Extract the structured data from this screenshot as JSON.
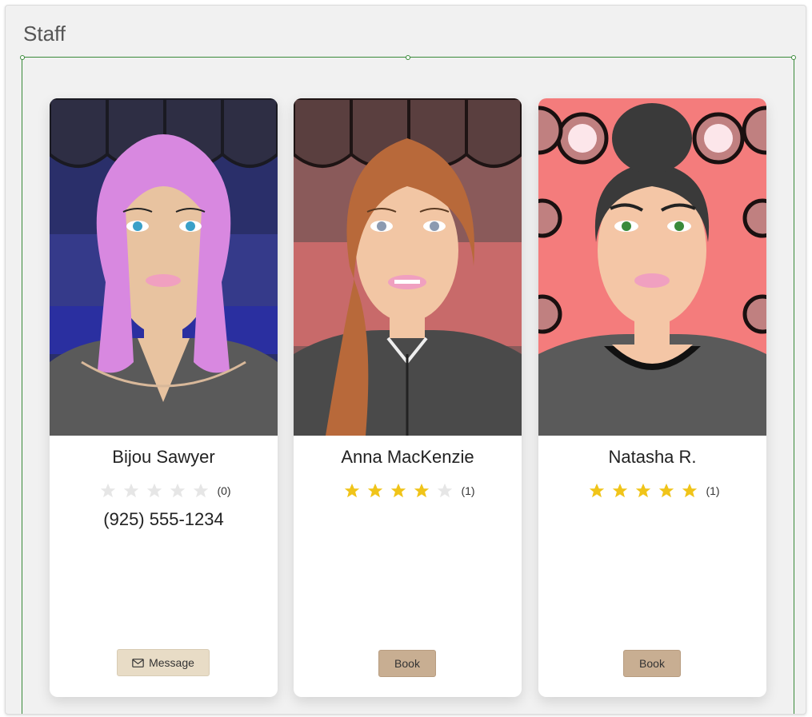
{
  "panel": {
    "title": "Staff"
  },
  "staff": [
    {
      "name": "Bijou Sawyer",
      "rating": 0,
      "rating_count": "(0)",
      "phone": "(925) 555-1234",
      "button_label": "Message",
      "button_icon": "envelope-icon",
      "hair_color": "#d888e0",
      "eye_color": "#3aa0c8",
      "background_color": "#2a2f6a"
    },
    {
      "name": "Anna MacKenzie",
      "rating": 4,
      "rating_count": "(1)",
      "phone": "",
      "button_label": "Book",
      "hair_color": "#b8693a",
      "eye_color": "#8c9ab0",
      "background_color": "#8a5a5a"
    },
    {
      "name": "Natasha R.",
      "rating": 5,
      "rating_count": "(1)",
      "phone": "",
      "button_label": "Book",
      "hair_color": "#3a3a3a",
      "eye_color": "#3a8a3a",
      "background_color": "#f47c7c"
    }
  ],
  "colors": {
    "star_filled": "#f0c419",
    "star_empty": "#e6e6e6",
    "selection_outline": "#3a8a3a",
    "button_book": "#c8ae92",
    "button_message": "#e8dcc6"
  }
}
